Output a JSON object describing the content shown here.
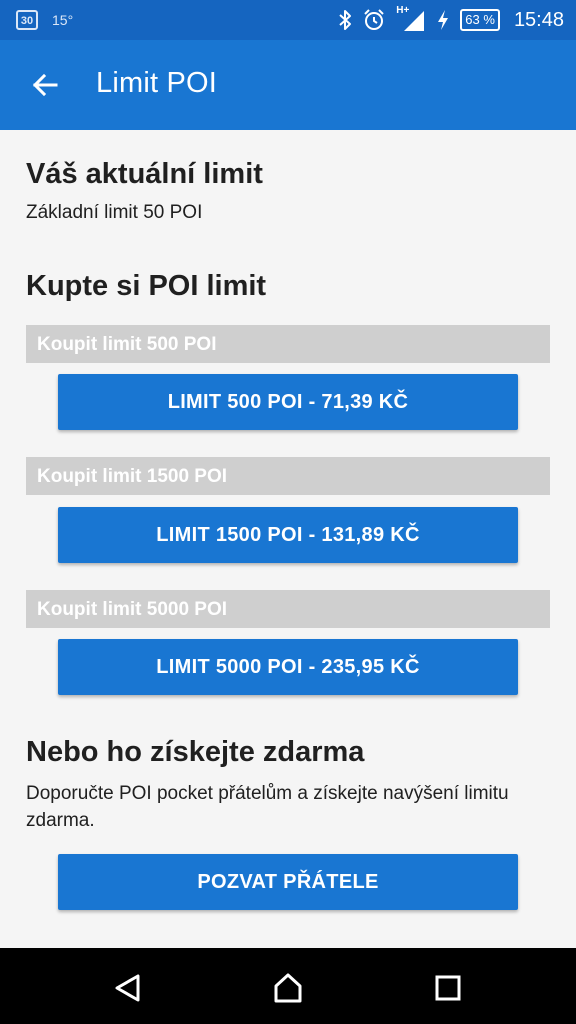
{
  "status_bar": {
    "calendar_day": "30",
    "temperature": "15°",
    "network": "H+",
    "battery": "63 %",
    "time": "15:48",
    "icons": [
      "calendar-icon",
      "bluetooth-icon",
      "alarm-icon",
      "signal-icon",
      "charging-icon",
      "battery-icon"
    ]
  },
  "app_bar": {
    "title": "Limit POI",
    "back_icon": "arrow-back-icon"
  },
  "current": {
    "heading": "Váš aktuální limit",
    "text": "Základní limit 50 POI"
  },
  "buy": {
    "heading": "Kupte si POI limit",
    "packages": [
      {
        "header": "Koupit limit 500 POI",
        "button": "LIMIT 500 POI - 71,39 KČ"
      },
      {
        "header": "Koupit limit 1500 POI",
        "button": "LIMIT 1500 POI - 131,89 KČ"
      },
      {
        "header": "Koupit limit 5000 POI",
        "button": "LIMIT 5000 POI - 235,95 KČ"
      }
    ]
  },
  "free": {
    "heading": "Nebo ho získejte zdarma",
    "text": "Doporučte POI pocket přátelům a získejte navýšení limitu zdarma.",
    "button": "POZVAT PŘÁTELE"
  },
  "colors": {
    "status_bar": "#1565c0",
    "app_bar": "#1976d2",
    "button": "#1976d2",
    "section_header": "#cfcfcf",
    "background": "#f5f5f5"
  }
}
